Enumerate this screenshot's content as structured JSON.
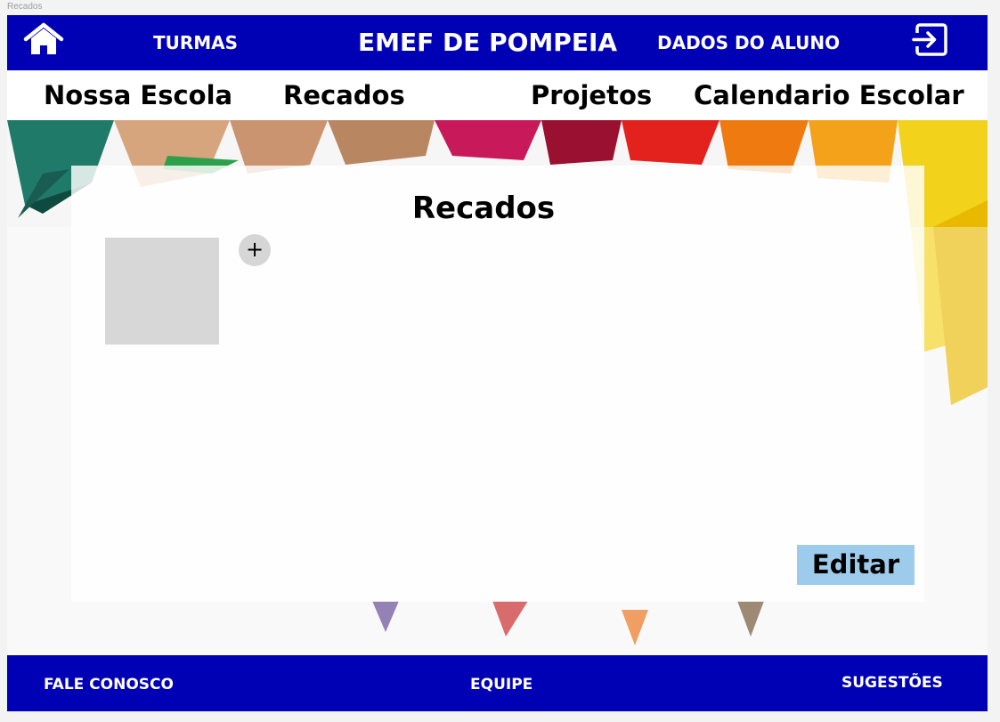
{
  "frame": {
    "title": "Recados"
  },
  "header": {
    "home_icon": "home-icon",
    "turmas_label": "TURMAS",
    "brand": "EMEF DE POMPEIA",
    "dados_label": "DADOS DO ALUNO",
    "logout_icon": "logout-icon",
    "color": "#0000b5"
  },
  "nav": {
    "items": [
      {
        "label": "Nossa Escola"
      },
      {
        "label": "Recados"
      },
      {
        "label": "Projetos"
      },
      {
        "label": "Calendario Escolar"
      }
    ]
  },
  "main": {
    "title": "Recados",
    "add_label": "+",
    "edit_label": "Editar",
    "edit_color": "#9dcbec",
    "background_image": "colored-pencils"
  },
  "footer": {
    "contact_label": "FALE CONOSCO",
    "team_label": "EQUIPE",
    "suggestions_label": "SUGESTÕES"
  }
}
